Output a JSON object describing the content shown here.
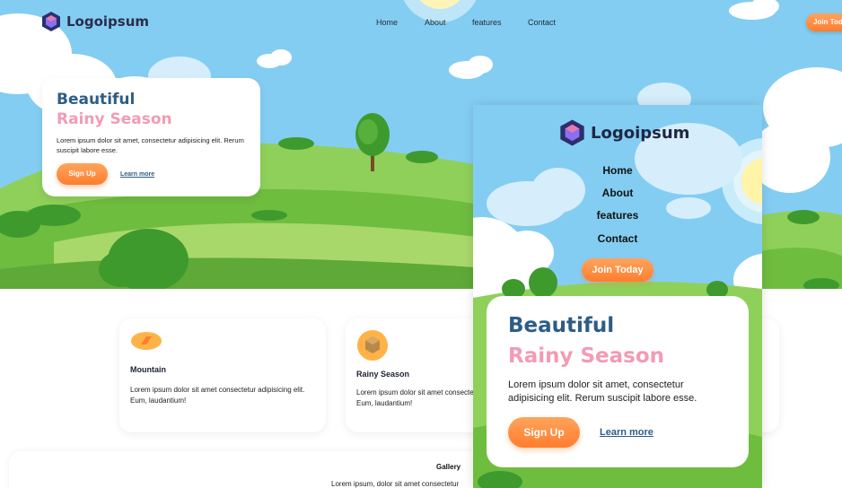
{
  "brand": {
    "name": "Logoipsum"
  },
  "nav": {
    "items": [
      "Home",
      "About",
      "features",
      "Contact"
    ],
    "join_label": "Join Today"
  },
  "hero": {
    "title_line1": "Beautiful",
    "title_line2": "Rainy Season",
    "description": "Lorem ipsum dolor sit amet, consectetur adipisicing elit. Rerum suscipit labore esse.",
    "signup_label": "Sign Up",
    "learn_more_label": "Learn more"
  },
  "features": [
    {
      "title": "Mountain",
      "description": "Lorem ipsum dolor sit amet consectetur adipisicing elit. Eum, laudantium!"
    },
    {
      "title": "Rainy Season",
      "description": "Lorem ipsum dolor sit amet consectetur adipisicing elit. Eum, laudantium!"
    }
  ],
  "gallery": {
    "title": "Gallery",
    "description": "Lorem ipsum, dolor sit amet consectetur"
  },
  "colors": {
    "accent_orange": "#ff7d2e",
    "title_blue": "#2c5d86",
    "title_pink": "#f39bb4",
    "sky": "#84cdf2",
    "grass": "#7cc24a"
  }
}
